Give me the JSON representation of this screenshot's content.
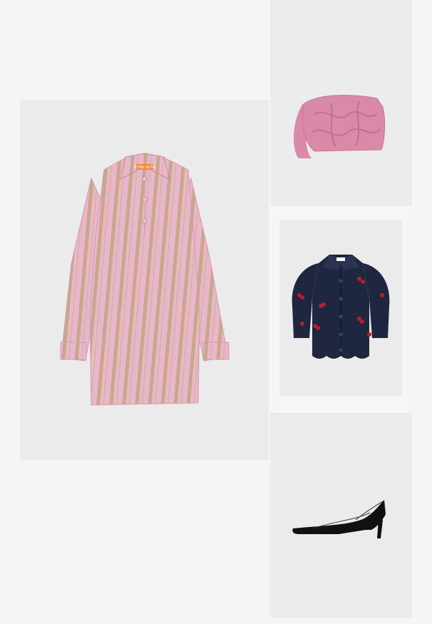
{
  "collage": {
    "items": [
      {
        "name": "striped-shirt-dress",
        "brand_tag": "STINE GOYA"
      },
      {
        "name": "quilted-shoulder-bag"
      },
      {
        "name": "cherry-embroidered-cardigan"
      },
      {
        "name": "black-patent-pumps"
      }
    ]
  },
  "colors": {
    "background": "#f5f5f5",
    "tile": "#ebebeb",
    "dress_pink": "#e9b6cd",
    "dress_stripe": "#c9a889",
    "bag_pink": "#d98aa8",
    "cardigan_navy": "#1f2640",
    "cherry_red": "#b3202c",
    "shoe_black": "#111111"
  }
}
